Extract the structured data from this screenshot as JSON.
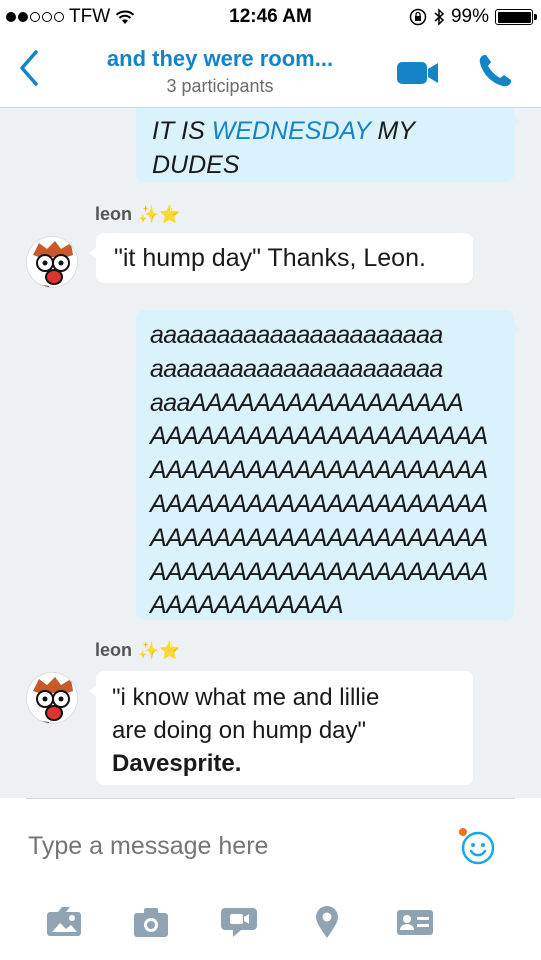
{
  "status": {
    "carrier": "TFW",
    "time": "12:46 AM",
    "battery": "99%"
  },
  "header": {
    "title": "and they were room...",
    "subtitle": "3 participants"
  },
  "messages": [
    {
      "direction": "outgoing",
      "line1_a": "IT IS ",
      "line1_link": "WEDNESDAY",
      "line1_b": " MY",
      "line2": "DUDES"
    },
    {
      "direction": "incoming",
      "sender": "leon",
      "sender_emoji": "✨⭐",
      "text": "\"it hump day\" Thanks, Leon."
    },
    {
      "direction": "outgoing",
      "lines": [
        "aaaaaaaaaaaaaaaaaaaaaa",
        "aaaaaaaaaaaaaaaaaaaaaa",
        "aaaAAAAAAAAAAAAAAAAA",
        "AAAAAAAAAAAAAAAAAAAAA",
        "AAAAAAAAAAAAAAAAAAAAA",
        "AAAAAAAAAAAAAAAAAAAAA",
        "AAAAAAAAAAAAAAAAAAAAA",
        "AAAAAAAAAAAAAAAAAAAAA",
        "AAAAAAAAAAAA"
      ]
    },
    {
      "direction": "incoming",
      "sender": "leon",
      "sender_emoji": "✨⭐",
      "line1": "\"i know what me and lillie",
      "line2": "are doing on hump day\"",
      "line3_bold": "Davesprite."
    }
  ],
  "composer": {
    "placeholder": "Type a message here"
  },
  "toolbar": {
    "icons": [
      "gallery-icon",
      "camera-icon",
      "video-message-icon",
      "location-icon",
      "contact-card-icon"
    ]
  },
  "colors": {
    "accent": "#1484c7",
    "outgoing_bubble": "#d9f2fc",
    "chat_background": "#eef1f4",
    "toolbar_icon": "#8fa3b2"
  }
}
